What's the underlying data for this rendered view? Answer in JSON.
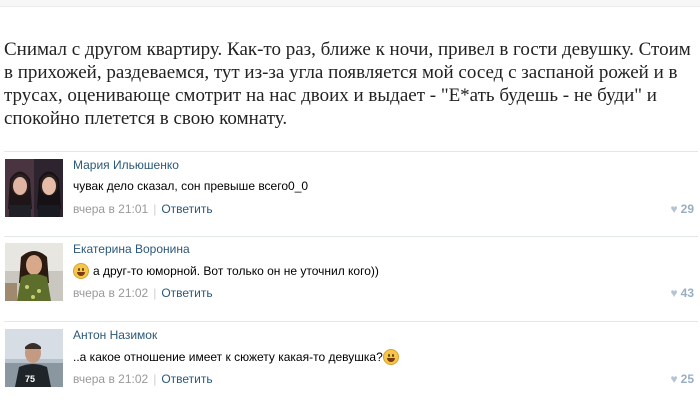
{
  "post": {
    "text": "Снимал с другом квартиру. Как-то раз, ближе к ночи, привел в гости девушку. Стоим в прихожей, раздеваемся, тут из-за угла появляется мой сосед с заспаной рожей и в трусах, оценивающе смотрит на нас двоих и выдает - \"Е*ать будешь - не буди\" и спокойно плетется в свою комнату."
  },
  "comments": [
    {
      "author": "Мария Ильюшенко",
      "text": "чувак дело сказал, сон превыше всего0_0",
      "time": "вчера в 21:01",
      "reply_label": "Ответить",
      "likes": "29",
      "avatar_icon": "user-photo-icon"
    },
    {
      "author": "Екатерина Воронина",
      "text": "а друг-то юморной. Вот только он не уточнил кого))",
      "time": "вчера в 21:02",
      "reply_label": "Ответить",
      "likes": "43",
      "avatar_icon": "user-photo-icon",
      "emoji": "smile-emoji-icon"
    },
    {
      "author": "Антон Назимок",
      "text": "..а какое отношение имеет к сюжету какая-то девушка?",
      "time": "вчера в 21:02",
      "reply_label": "Ответить",
      "likes": "25",
      "avatar_icon": "user-photo-icon",
      "emoji": "smile-emoji-icon"
    }
  ],
  "meta": {
    "divider": "|",
    "heart_icon": "heart-icon",
    "link_color": "#2b587a",
    "meta_color": "#999999"
  }
}
